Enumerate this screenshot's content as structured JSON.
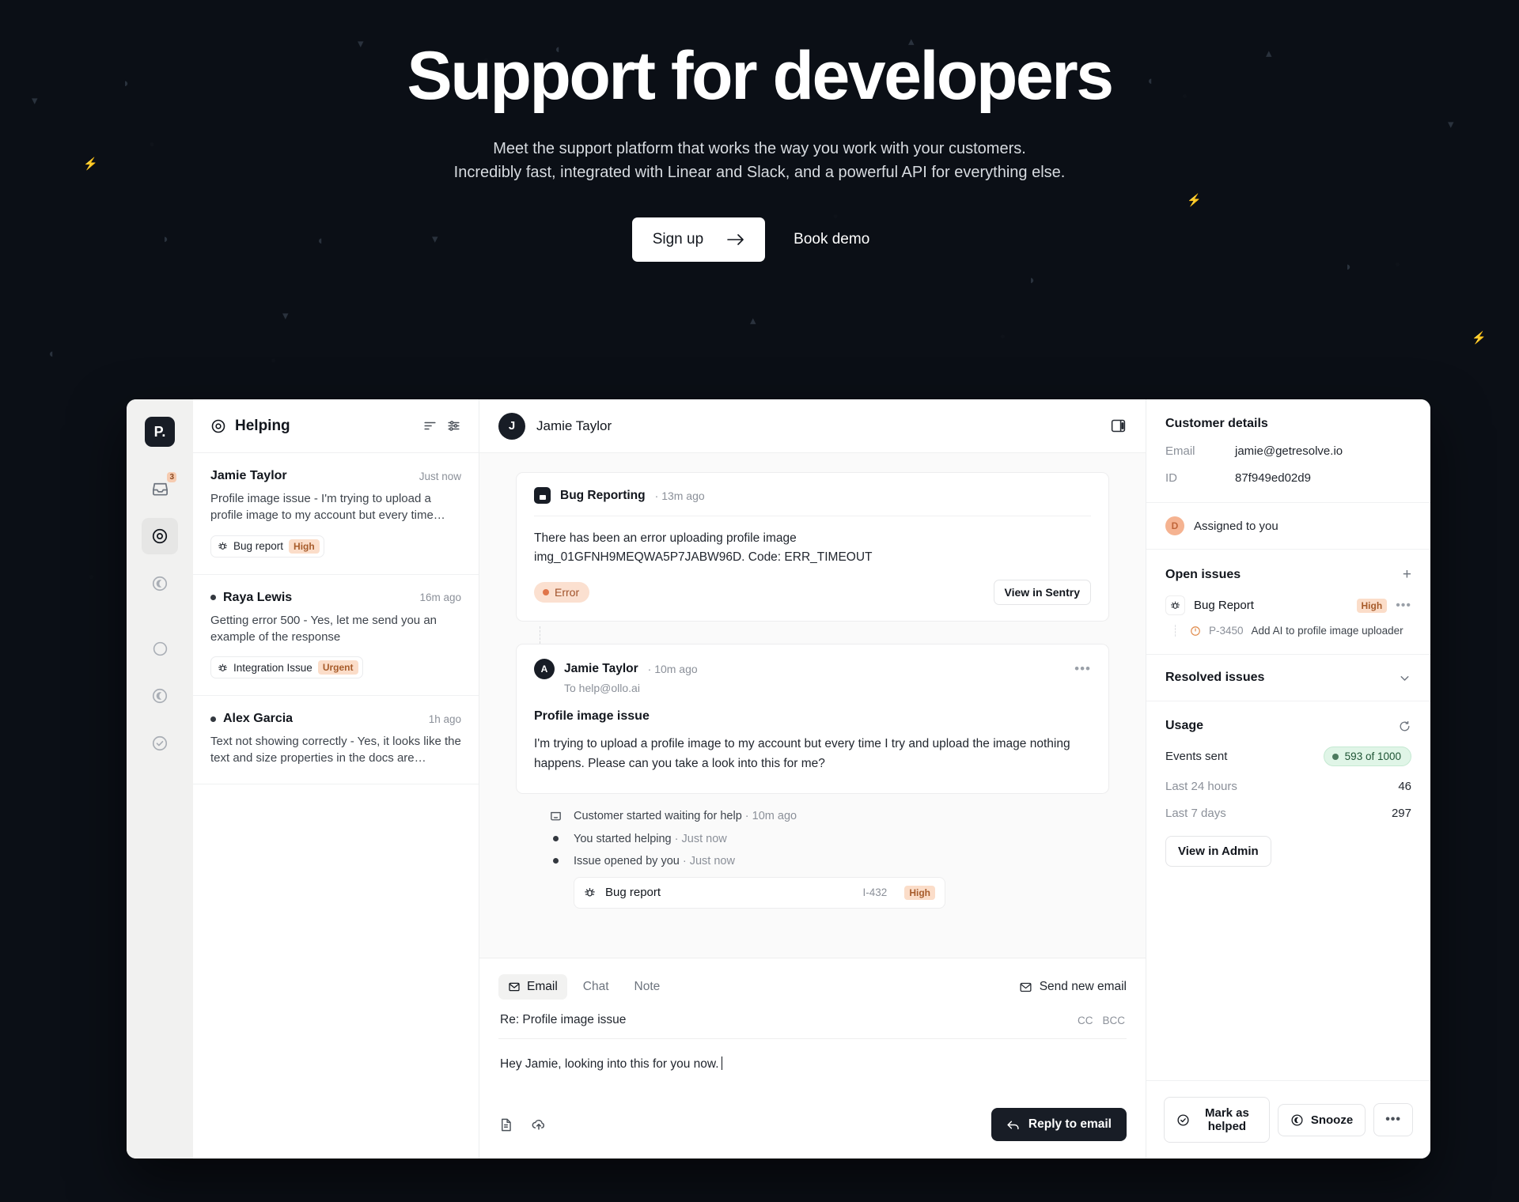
{
  "hero": {
    "title": "Support for developers",
    "subtitle_line1": "Meet the support platform that works the way you work with your customers.",
    "subtitle_line2": "Incredibly fast, integrated with Linear and Slack, and a powerful API for everything else.",
    "signup_label": "Sign up",
    "demo_label": "Book demo"
  },
  "app": {
    "rail": {
      "logo": "P.",
      "inbox_badge": "3"
    },
    "list": {
      "title": "Helping",
      "conversations": [
        {
          "name": "Jamie Taylor",
          "time": "Just now",
          "preview": "Profile image issue - I'm trying to upload a profile image to my account but every time…",
          "tag": "Bug report",
          "priority": "High"
        },
        {
          "name": "Raya Lewis",
          "time": "16m ago",
          "preview": "Getting error 500 - Yes, let me send you an example of the response",
          "tag": "Integration Issue",
          "priority": "Urgent"
        },
        {
          "name": "Alex Garcia",
          "time": "1h ago",
          "preview": "Text not showing correctly - Yes, it looks like the text and size properties in the docs are…",
          "tag": "",
          "priority": ""
        }
      ]
    },
    "thread": {
      "header_name": "Jamie Taylor",
      "header_avatar": "J",
      "bug_card": {
        "app_name": "Bug Reporting",
        "time": "13m ago",
        "text_line1": "There has been an error uploading profile image",
        "text_line2": "img_01GFNH9MEQWA5P7JABW96D. Code: ERR_TIMEOUT",
        "status": "Error",
        "action": "View in Sentry"
      },
      "message": {
        "avatar": "A",
        "name": "Jamie Taylor",
        "time": "10m ago",
        "to": "To help@ollo.ai",
        "subject": "Profile image issue",
        "body": "I'm trying to upload a profile image to my account but every time I try and upload the image nothing happens. Please can you take a look into this for me?"
      },
      "events": [
        {
          "text": "Customer started waiting for help",
          "time": "10m ago"
        },
        {
          "text": "You started helping",
          "time": "Just now"
        },
        {
          "text": "Issue opened by you",
          "time": "Just now"
        }
      ],
      "event_card": {
        "title": "Bug report",
        "id": "I-432",
        "priority": "High"
      }
    },
    "composer": {
      "tabs": [
        "Email",
        "Chat",
        "Note"
      ],
      "active_tab": "Email",
      "send_new_label": "Send new email",
      "subject": "Re: Profile image issue",
      "cc": "CC",
      "bcc": "BCC",
      "draft_text": "Hey Jamie, looking into this for you now.",
      "reply_label": "Reply to email"
    },
    "details": {
      "customer_title": "Customer details",
      "email_key": "Email",
      "email_value": "jamie@getresolve.io",
      "id_key": "ID",
      "id_value": "87f949ed02d9",
      "assigned_avatar": "D",
      "assigned_text": "Assigned to you",
      "open_issues_title": "Open issues",
      "issue": {
        "name": "Bug Report",
        "priority": "High",
        "sub_id": "P-3450",
        "sub_text": "Add AI to profile image uploader"
      },
      "resolved_title": "Resolved issues",
      "usage_title": "Usage",
      "events_sent_key": "Events sent",
      "events_sent_value": "593 of 1000",
      "last_24_key": "Last 24 hours",
      "last_24_value": "46",
      "last_7_key": "Last 7 days",
      "last_7_value": "297",
      "view_admin_label": "View in Admin",
      "mark_helped_label": "Mark as helped",
      "snooze_label": "Snooze"
    }
  },
  "colors": {
    "accent_peach": "#f5b391",
    "dark": "#181d26",
    "green_pill": "#e0f5e7"
  }
}
